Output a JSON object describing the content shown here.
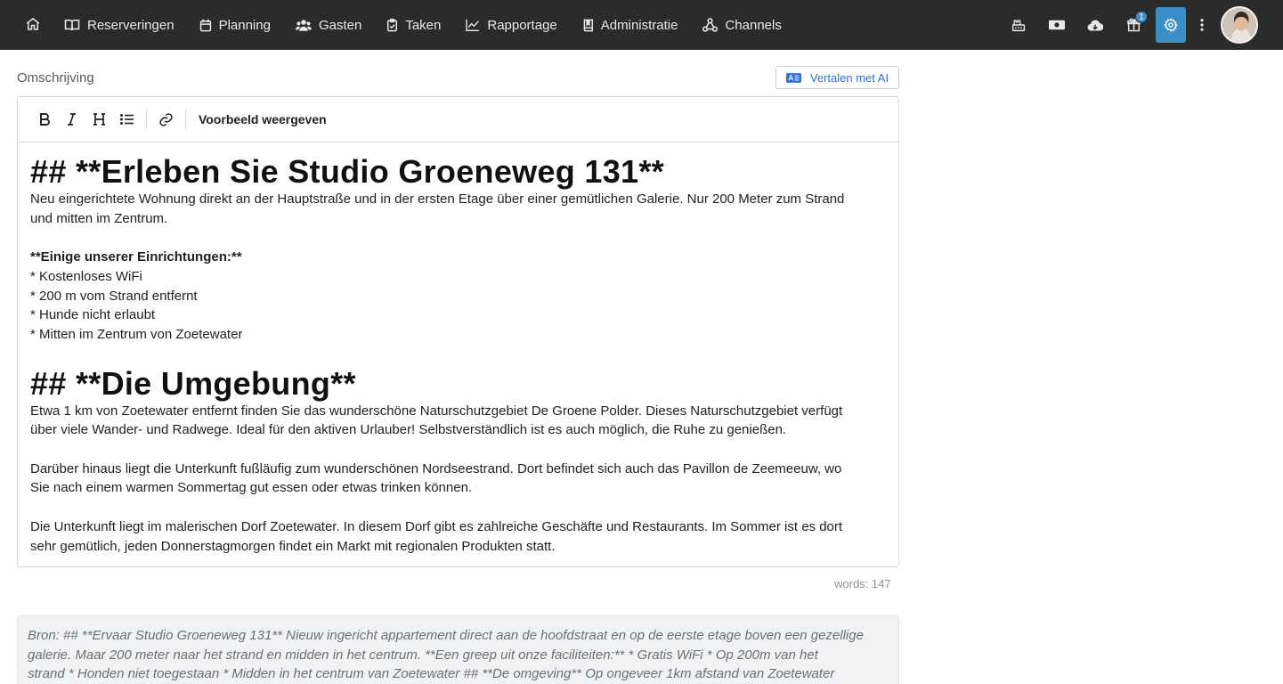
{
  "nav": {
    "home_icon": "home-icon",
    "items": [
      {
        "label": "Reserveringen",
        "icon": "book-open-icon"
      },
      {
        "label": "Planning",
        "icon": "calendar-icon"
      },
      {
        "label": "Gasten",
        "icon": "users-icon"
      },
      {
        "label": "Taken",
        "icon": "clipboard-check-icon"
      },
      {
        "label": "Rapportage",
        "icon": "line-chart-icon"
      },
      {
        "label": "Administratie",
        "icon": "book-icon"
      },
      {
        "label": "Channels",
        "icon": "network-icon"
      }
    ],
    "right_icons": [
      "cash-register-icon",
      "money-icon",
      "cloud-download-icon",
      "gift-icon",
      "gear-icon",
      "more-vertical-icon"
    ],
    "gift_badge": "1",
    "accent_color": "#3b8fc6"
  },
  "description": {
    "label": "Omschrijving",
    "translate_button": "Vertalen met AI",
    "toolbar": {
      "bold_icon": "bold-icon",
      "italic_icon": "italic-icon",
      "heading_icon": "heading-icon",
      "list_icon": "list-icon",
      "link_icon": "link-icon",
      "preview_label": "Voorbeeld weergeven"
    },
    "content": {
      "heading1": "## **Erleben Sie Studio Groeneweg 131**",
      "intro_line1": "Neu eingerichtete Wohnung direkt an der Hauptstraße und in der ersten Etage über einer gemütlichen Galerie. Nur 200 Meter zum Strand",
      "intro_line2": "und mitten im Zentrum.",
      "facilities_title": "**Einige unserer Einrichtungen:**",
      "facilities": [
        "* Kostenloses WiFi",
        "* 200 m vom Strand entfernt",
        "* Hunde nicht erlaubt",
        "* Mitten im Zentrum von Zoetewater"
      ],
      "heading2": "## **Die Umgebung**",
      "para1_line1": "Etwa 1 km von Zoetewater entfernt finden Sie das wunderschöne Naturschutzgebiet De Groene Polder. Dieses Naturschutzgebiet verfügt",
      "para1_line2": "über viele Wander- und Radwege. Ideal für den aktiven Urlauber! Selbstverständlich ist es auch möglich, die Ruhe zu genießen.",
      "para2_line1": "Darüber hinaus liegt die Unterkunft fußläufig zum wunderschönen Nordseestrand. Dort befindet sich auch das Pavillon de Zeemeeuw, wo",
      "para2_line2": "Sie nach einem warmen Sommertag gut essen oder etwas trinken können.",
      "para3_line1": "Die Unterkunft liegt im malerischen Dorf Zoetewater. In diesem Dorf gibt es zahlreiche Geschäfte und Restaurants. Im Sommer ist es dort",
      "para3_line2": "sehr gemütlich, jeden Donnerstagmorgen findet ein Markt mit regionalen Produkten statt."
    },
    "word_count": "words: 147",
    "source": {
      "line1": "Bron: ## **Ervaar Studio Groeneweg 131** Nieuw ingericht appartement direct aan de hoofdstraat en op de eerste etage boven een gezellige",
      "line2": "galerie. Maar 200 meter naar het strand en midden in het centrum. **Een greep uit onze faciliteiten:** * Gratis WiFi * Op 200m van het",
      "line3": "strand * Honden niet toegestaan * Midden in het centrum van Zoetewater ## **De omgeving** Op ongeveer 1km afstand van Zoetewater"
    }
  }
}
